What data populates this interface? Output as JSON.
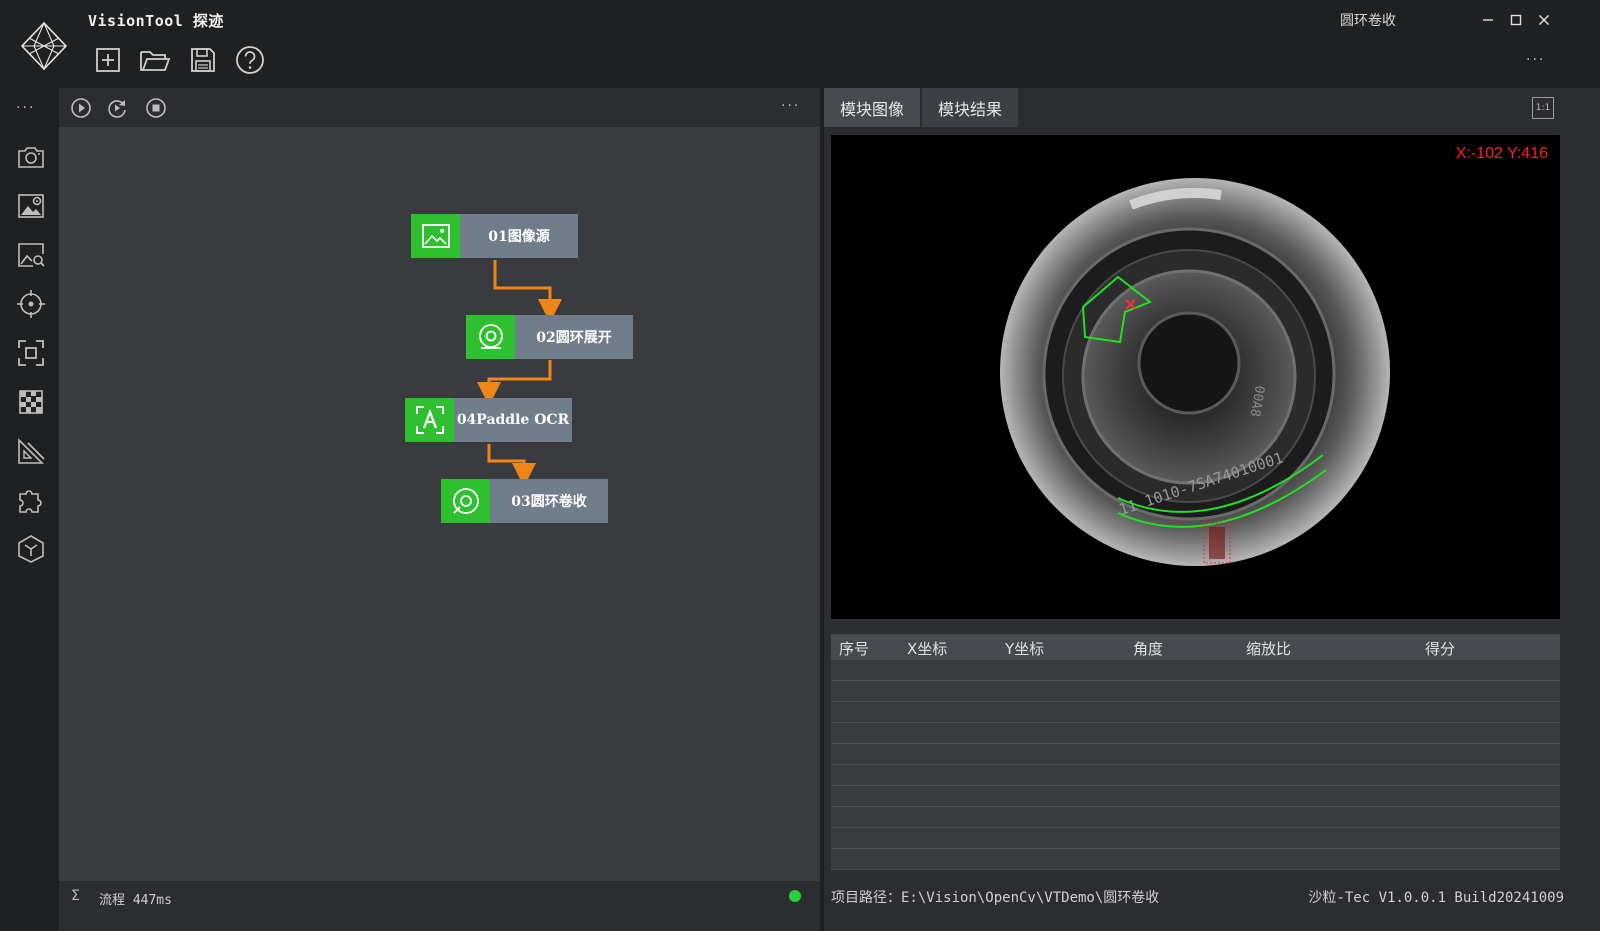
{
  "app": {
    "title": "VisionTool 探迹",
    "window_name": "圆环卷收",
    "logo_icon": "diamond-logo-icon"
  },
  "toolbar": {
    "items": [
      {
        "name": "new",
        "icon": "new-file-icon"
      },
      {
        "name": "open",
        "icon": "folder-open-icon"
      },
      {
        "name": "save",
        "icon": "save-icon"
      },
      {
        "name": "help",
        "icon": "help-icon"
      }
    ],
    "more_label": "···"
  },
  "window_controls": {
    "minimize": "—",
    "maximize": "☐",
    "close": "✕"
  },
  "sidebar": {
    "more_label": "···",
    "items": [
      {
        "name": "camera",
        "icon": "camera-icon"
      },
      {
        "name": "image-settings",
        "icon": "image-gear-icon"
      },
      {
        "name": "image-search",
        "icon": "image-search-icon"
      },
      {
        "name": "locate",
        "icon": "crosshair-icon"
      },
      {
        "name": "detect",
        "icon": "focus-frame-icon"
      },
      {
        "name": "calibrate",
        "icon": "checkerboard-icon"
      },
      {
        "name": "measure",
        "icon": "ruler-triangle-icon"
      },
      {
        "name": "plugins",
        "icon": "puzzle-icon"
      },
      {
        "name": "3d",
        "icon": "cube-icon"
      }
    ]
  },
  "flow": {
    "tools": [
      {
        "name": "run",
        "icon": "play-circle-icon"
      },
      {
        "name": "loop",
        "icon": "loop-run-icon"
      },
      {
        "name": "stop",
        "icon": "stop-circle-icon"
      }
    ],
    "more_label": "···",
    "nodes": [
      {
        "label": "01图像源",
        "icon": "image-icon"
      },
      {
        "label": "02圆环展开",
        "icon": "ring-unwrap-icon"
      },
      {
        "label": "04Paddle OCR",
        "icon": "ocr-icon"
      },
      {
        "label": "03圆环卷收",
        "icon": "ring-wrap-icon"
      }
    ],
    "connector_color": "#f0861a",
    "node_accent": "#2ec02e"
  },
  "status_left": {
    "sigma": "Σ",
    "flow_time": "流程 447ms",
    "status_color": "#27d13a"
  },
  "right": {
    "tabs": [
      "模块图像",
      "模块结果"
    ],
    "fit_label": "1:1",
    "coordinate_readout": "X:-102 Y:416",
    "table": {
      "columns": [
        "序号",
        "X坐标",
        "Y坐标",
        "角度",
        "缩放比",
        "得分"
      ],
      "rows": []
    }
  },
  "status_right": {
    "project_path": "项目路径：E:\\Vision\\OpenCv\\VTDemo\\圆环卷收",
    "version": "沙粒-Tec V1.0.0.1 Build20241009"
  }
}
